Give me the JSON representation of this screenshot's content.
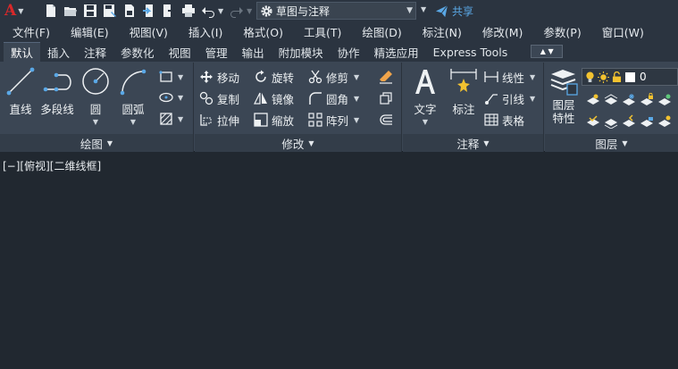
{
  "app": {
    "logo_text": "A"
  },
  "quick_access": {
    "icons": [
      "new-file-icon",
      "open-folder-icon",
      "save-icon",
      "save-as-icon",
      "publish-icon",
      "import-icon",
      "export-icon",
      "print-icon",
      "undo-icon",
      "redo-icon"
    ],
    "workspace_label": "草图与注释",
    "share_label": "共享"
  },
  "menu": {
    "items": [
      "文件(F)",
      "编辑(E)",
      "视图(V)",
      "插入(I)",
      "格式(O)",
      "工具(T)",
      "绘图(D)",
      "标注(N)",
      "修改(M)",
      "参数(P)",
      "窗口(W)"
    ]
  },
  "tabs": {
    "items": [
      "默认",
      "插入",
      "注释",
      "参数化",
      "视图",
      "管理",
      "输出",
      "附加模块",
      "协作",
      "精选应用",
      "Express Tools"
    ],
    "active": "默认"
  },
  "panels": {
    "draw": {
      "title": "绘图",
      "line": "直线",
      "polyline": "多段线",
      "circle": "圆",
      "arc": "圆弧"
    },
    "modify": {
      "title": "修改",
      "move": "移动",
      "rotate": "旋转",
      "trim": "修剪",
      "copy": "复制",
      "mirror": "镜像",
      "fillet": "圆角",
      "stretch": "拉伸",
      "scale": "缩放",
      "array": "阵列"
    },
    "annotation": {
      "title": "注释",
      "text": "文字",
      "dimension": "标注",
      "linear": "线性",
      "leader": "引线",
      "table": "表格"
    },
    "layers": {
      "title": "图层",
      "properties_line1": "图层",
      "properties_line2": "特性",
      "current_layer": "0"
    }
  },
  "viewport": {
    "label": "[−][俯视][二维线框]"
  },
  "colors": {
    "background": "#212830",
    "ribbon": "#3b4654",
    "accent_blue": "#5aa8e6",
    "logo_red": "#d8282a",
    "layer_yellow": "#f2c230"
  }
}
